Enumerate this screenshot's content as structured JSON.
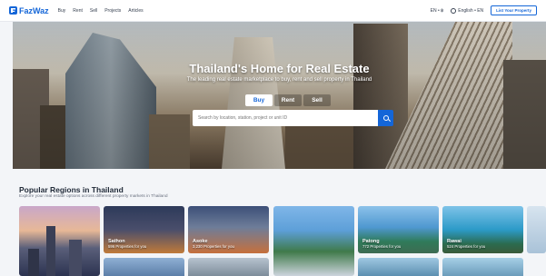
{
  "nav": {
    "logo_text": "FazWaz",
    "links": [
      "Buy",
      "Rent",
      "Sell",
      "Projects",
      "Articles"
    ],
    "currency": "EN • ฿",
    "language": "English • EN",
    "list_button": "List Your Property"
  },
  "hero": {
    "title": "Thailand's Home for Real Estate",
    "subtitle": "The leading real estate marketplace to buy, rent and sell property in Thailand",
    "tabs": [
      {
        "label": "Buy",
        "active": true
      },
      {
        "label": "Rent",
        "active": false
      },
      {
        "label": "Sell",
        "active": false
      }
    ],
    "search_placeholder": "Search by location, station, project or unit ID",
    "accent": "#1466d8"
  },
  "regions": {
    "title": "Popular Regions in Thailand",
    "subtitle": "Explore your real estate options across different property markets in Thailand",
    "cards": [
      {
        "name": "",
        "count": ""
      },
      {
        "name": "Sathon",
        "count": "596 Properties for you"
      },
      {
        "name": "Asoke",
        "count": "3,230 Properties for you"
      },
      {
        "name": "",
        "count": ""
      },
      {
        "name": "Patong",
        "count": "772 Properties for you"
      },
      {
        "name": "Rawai",
        "count": "524 Properties for you"
      }
    ]
  }
}
